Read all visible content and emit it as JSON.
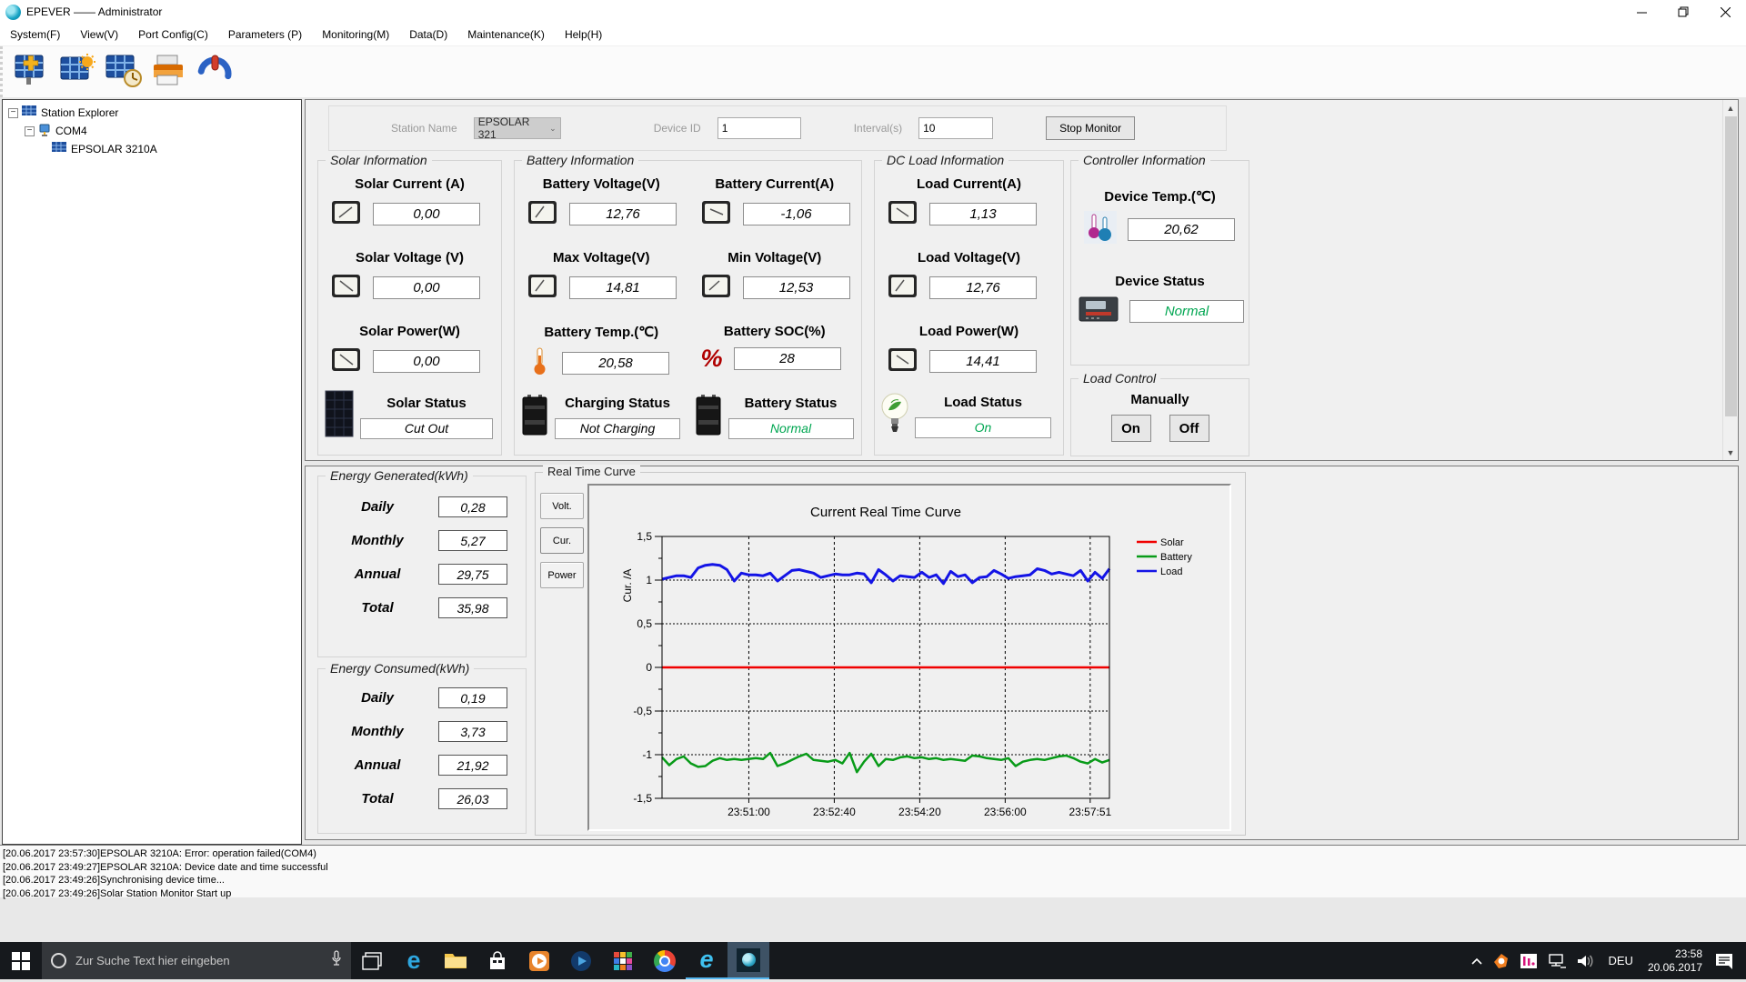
{
  "window": {
    "title": "EPEVER —— Administrator"
  },
  "menu": {
    "items": [
      "System(F)",
      "View(V)",
      "Port Config(C)",
      "Parameters (P)",
      "Monitoring(M)",
      "Data(D)",
      "Maintenance(K)",
      "Help(H)"
    ]
  },
  "toolbar": {
    "icons": [
      "add-station-icon",
      "solar-monitor-icon",
      "station-history-icon",
      "printer-icon",
      "power-exit-icon"
    ]
  },
  "tree": {
    "root": "Station Explorer",
    "port": "COM4",
    "device": "EPSOLAR 3210A"
  },
  "monitor_form": {
    "station_name_label": "Station Name",
    "station_name_value": "EPSOLAR 321",
    "device_id_label": "Device ID",
    "device_id_value": "1",
    "interval_label": "Interval(s)",
    "interval_value": "10",
    "stop_button": "Stop Monitor"
  },
  "solar": {
    "title": "Solar Information",
    "items": [
      {
        "label": "Solar Current (A)",
        "value": "0,00"
      },
      {
        "label": "Solar Voltage (V)",
        "value": "0,00"
      },
      {
        "label": "Solar Power(W)",
        "value": "0,00"
      }
    ],
    "status_label": "Solar Status",
    "status_value": "Cut Out"
  },
  "battery": {
    "title": "Battery Information",
    "items": [
      {
        "label": "Battery Voltage(V)",
        "value": "12,76"
      },
      {
        "label": "Battery Current(A)",
        "value": "-1,06"
      },
      {
        "label": "Max Voltage(V)",
        "value": "14,81"
      },
      {
        "label": "Min Voltage(V)",
        "value": "12,53"
      },
      {
        "label": "Battery Temp.(℃)",
        "value": "20,58"
      },
      {
        "label": "Battery SOC(%)",
        "value": "28"
      }
    ],
    "charging_status_label": "Charging Status",
    "charging_status_value": "Not Charging",
    "battery_status_label": "Battery Status",
    "battery_status_value": "Normal"
  },
  "dc_load": {
    "title": "DC Load Information",
    "items": [
      {
        "label": "Load Current(A)",
        "value": "1,13"
      },
      {
        "label": "Load Voltage(V)",
        "value": "12,76"
      },
      {
        "label": "Load Power(W)",
        "value": "14,41"
      }
    ],
    "status_label": "Load Status",
    "status_value": "On"
  },
  "controller": {
    "title": "Controller Information",
    "temp_label": "Device Temp.(℃)",
    "temp_value": "20,62",
    "status_label": "Device Status",
    "status_value": "Normal"
  },
  "load_control": {
    "title": "Load Control",
    "subtitle": "Manually",
    "on_button": "On",
    "off_button": "Off"
  },
  "energy_generated": {
    "title": "Energy Generated(kWh)",
    "rows": [
      {
        "label": "Daily",
        "value": "0,28"
      },
      {
        "label": "Monthly",
        "value": "5,27"
      },
      {
        "label": "Annual",
        "value": "29,75"
      },
      {
        "label": "Total",
        "value": "35,98"
      }
    ]
  },
  "energy_consumed": {
    "title": "Energy Consumed(kWh)",
    "rows": [
      {
        "label": "Daily",
        "value": "0,19"
      },
      {
        "label": "Monthly",
        "value": "3,73"
      },
      {
        "label": "Annual",
        "value": "21,92"
      },
      {
        "label": "Total",
        "value": "26,03"
      }
    ]
  },
  "curve": {
    "group_title": "Real Time Curve",
    "tabs": [
      "Volt.",
      "Cur.",
      "Power"
    ],
    "active_tab": "Cur."
  },
  "chart_data": {
    "type": "line",
    "title": "Current Real Time Curve",
    "xlabel": "",
    "ylabel": "Cur. /A",
    "ylim": [
      -1.5,
      1.5
    ],
    "grid": true,
    "legend_position": "right-top",
    "yticks": [
      {
        "v": 1.5,
        "label": "1,5"
      },
      {
        "v": 1,
        "label": "1"
      },
      {
        "v": 0.5,
        "label": "0,5"
      },
      {
        "v": 0,
        "label": "0"
      },
      {
        "v": -0.5,
        "label": "-0,5"
      },
      {
        "v": -1,
        "label": "-1"
      },
      {
        "v": -1.5,
        "label": "-1,5"
      }
    ],
    "xticks": [
      {
        "pos": 0.194,
        "label": "23:51:00"
      },
      {
        "pos": 0.385,
        "label": "23:52:40"
      },
      {
        "pos": 0.576,
        "label": "23:54:20"
      },
      {
        "pos": 0.767,
        "label": "23:56:00"
      },
      {
        "pos": 0.957,
        "label": "23:57:51"
      }
    ],
    "series": [
      {
        "name": "Solar",
        "color": "#f00000",
        "width": 2.5,
        "values": [
          0,
          0,
          0,
          0,
          0,
          0,
          0,
          0,
          0,
          0,
          0,
          0,
          0
        ]
      },
      {
        "name": "Battery",
        "color": "#089b18",
        "width": 2.5,
        "values": [
          -1.03,
          -1.12,
          -1.05,
          -1.02,
          -1.1,
          -1.14,
          -1.13,
          -1.07,
          -1.04,
          -1.06,
          -1.05,
          -1.06,
          -1.05,
          -1.04,
          -1.05,
          -0.98,
          -1.13,
          -1.1,
          -1.06,
          -1.02,
          -0.99,
          -1.06,
          -1.07,
          -1.08,
          -1.06,
          -1.1,
          -0.98,
          -1.2,
          -1.08,
          -0.99,
          -1.13,
          -1.05,
          -1.06,
          -1.03,
          -1.02,
          -1.04,
          -1.03,
          -1.05,
          -1.04,
          -1.06,
          -1.05,
          -1.06,
          -1.07,
          -1.01,
          -1.02,
          -1.04,
          -1.05,
          -1.06,
          -1.04,
          -1.13,
          -1.08,
          -1.06,
          -1.05,
          -1.06,
          -1.04,
          -1.02,
          -1.01,
          -1.04,
          -1.08,
          -1.1,
          -1.05,
          -1.09,
          -1.06
        ]
      },
      {
        "name": "Load",
        "color": "#1414e6",
        "width": 3,
        "values": [
          1.01,
          1.03,
          1.05,
          1.05,
          1.03,
          1.14,
          1.17,
          1.18,
          1.17,
          1.12,
          0.99,
          1.08,
          1.06,
          1.06,
          1.05,
          1.08,
          0.99,
          1.05,
          1.11,
          1.12,
          1.1,
          1.08,
          1.03,
          1.05,
          1.07,
          1.06,
          1.06,
          1.08,
          1.07,
          0.97,
          1.12,
          1.06,
          0.99,
          1.05,
          1.04,
          1.03,
          1.09,
          1.03,
          1.06,
          0.96,
          1.1,
          1.04,
          1.06,
          0.97,
          1.03,
          1.04,
          1.11,
          1.07,
          1.02,
          1.04,
          1.05,
          1.06,
          1.13,
          1.11,
          1.07,
          1.09,
          1.07,
          1.05,
          1.11,
          0.99,
          1.09,
          1.02,
          1.13
        ]
      }
    ]
  },
  "log": {
    "lines": [
      "[20.06.2017 23:57:30]EPSOLAR 3210A: Error: operation failed(COM4)",
      "[20.06.2017 23:49:27]EPSOLAR 3210A: Device date and time successful",
      "[20.06.2017 23:49:26]Synchronising device time...",
      "[20.06.2017 23:49:26]Solar Station Monitor Start up"
    ]
  },
  "taskbar": {
    "search_placeholder": "Zur Suche Text hier eingeben",
    "app_icons": [
      "start",
      "task-view",
      "edge",
      "file-explorer",
      "store",
      "media-player",
      "video-player",
      "app-grid",
      "chrome",
      "internet-explorer",
      "epever"
    ],
    "tray_icons": [
      "tray-expand",
      "avast",
      "usage-monitor",
      "network",
      "volume",
      "notifications"
    ],
    "language": "DEU",
    "time": "23:58",
    "date": "20.06.2017"
  }
}
